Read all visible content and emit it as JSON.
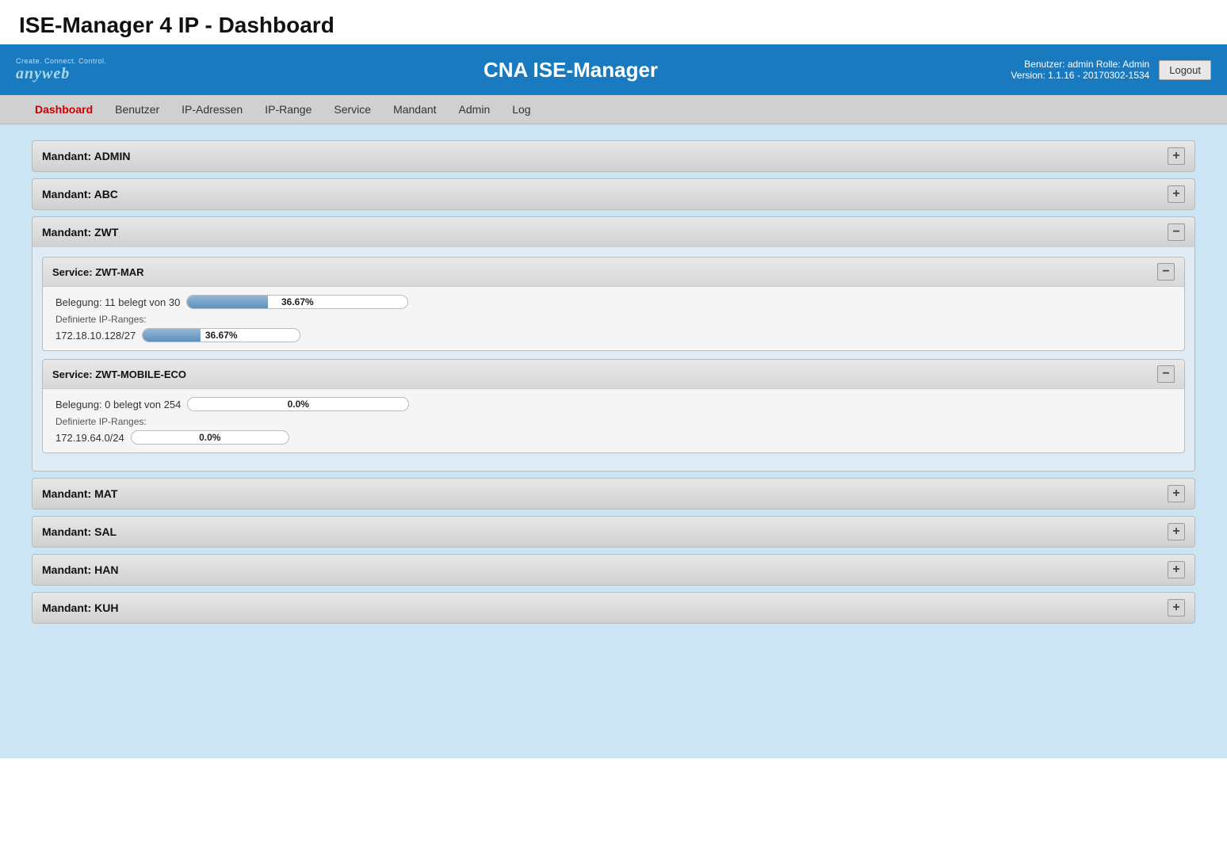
{
  "page": {
    "title": "ISE-Manager 4 IP - Dashboard"
  },
  "header": {
    "logo_tagline": "Create. Connect. Control.",
    "logo_name": "anyweb",
    "app_title": "CNA ISE-Manager",
    "user_info": "Benutzer: admin  Rolle: Admin",
    "version_info": "Version: 1.1.16 - 20170302-1534",
    "logout_label": "Logout"
  },
  "navbar": {
    "items": [
      {
        "label": "Dashboard",
        "active": true
      },
      {
        "label": "Benutzer",
        "active": false
      },
      {
        "label": "IP-Adressen",
        "active": false
      },
      {
        "label": "IP-Range",
        "active": false
      },
      {
        "label": "Service",
        "active": false
      },
      {
        "label": "Mandant",
        "active": false
      },
      {
        "label": "Admin",
        "active": false
      },
      {
        "label": "Log",
        "active": false
      }
    ]
  },
  "mandants": [
    {
      "id": "ADMIN",
      "label": "Mandant: ADMIN",
      "expanded": false,
      "toggle": "+"
    },
    {
      "id": "ABC",
      "label": "Mandant: ABC",
      "expanded": false,
      "toggle": "+"
    },
    {
      "id": "ZWT",
      "label": "Mandant: ZWT",
      "expanded": true,
      "toggle": "−",
      "services": [
        {
          "id": "ZWT-MAR",
          "label": "Service: ZWT-MAR",
          "expanded": true,
          "toggle": "−",
          "belegung_text": "Belegung: 11 belegt von 30",
          "belegung_pct": 36.67,
          "belegung_pct_label": "36.67%",
          "ip_ranges_label": "Definierte IP-Ranges:",
          "ip_ranges": [
            {
              "range": "172.18.10.128/27",
              "pct": 36.67,
              "pct_label": "36.67%"
            }
          ]
        },
        {
          "id": "ZWT-MOBILE-ECO",
          "label": "Service: ZWT-MOBILE-ECO",
          "expanded": true,
          "toggle": "−",
          "belegung_text": "Belegung: 0 belegt von 254",
          "belegung_pct": 0,
          "belegung_pct_label": "0.0%",
          "ip_ranges_label": "Definierte IP-Ranges:",
          "ip_ranges": [
            {
              "range": "172.19.64.0/24",
              "pct": 0,
              "pct_label": "0.0%"
            }
          ]
        }
      ]
    },
    {
      "id": "MAT",
      "label": "Mandant: MAT",
      "expanded": false,
      "toggle": "+"
    },
    {
      "id": "SAL",
      "label": "Mandant: SAL",
      "expanded": false,
      "toggle": "+"
    },
    {
      "id": "HAN",
      "label": "Mandant: HAN",
      "expanded": false,
      "toggle": "+"
    },
    {
      "id": "KUH",
      "label": "Mandant: KUH",
      "expanded": false,
      "toggle": "+"
    }
  ]
}
